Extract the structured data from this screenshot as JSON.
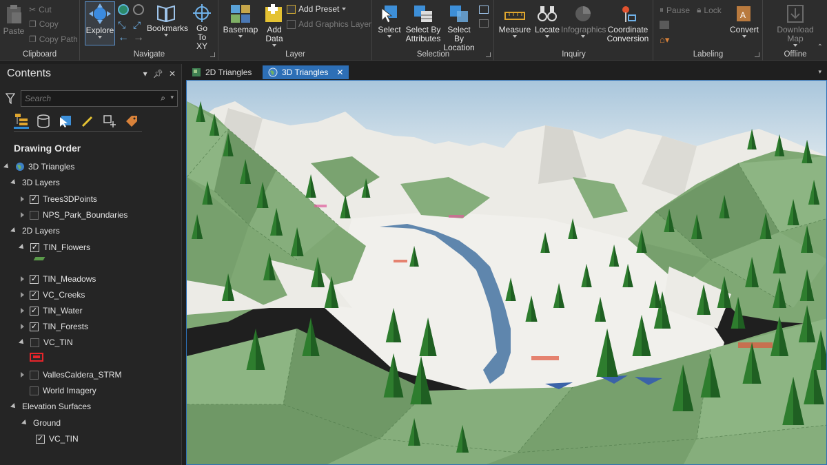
{
  "ribbon": {
    "clipboard": {
      "label": "Clipboard",
      "paste": "Paste",
      "cut": "Cut",
      "copy": "Copy",
      "copy_path": "Copy Path"
    },
    "navigate": {
      "label": "Navigate",
      "explore": "Explore",
      "bookmarks": "Bookmarks",
      "go_to_xy": "Go To XY"
    },
    "layer": {
      "label": "Layer",
      "basemap": "Basemap",
      "add_data": "Add Data",
      "add_preset": "Add Preset",
      "add_graphics_layer": "Add Graphics Layer"
    },
    "selection": {
      "label": "Selection",
      "select": "Select",
      "select_by_attributes": "Select By Attributes",
      "select_by_location": "Select By Location"
    },
    "inquiry": {
      "label": "Inquiry",
      "measure": "Measure",
      "locate": "Locate",
      "infographics": "Infographics",
      "coordinate_conversion": "Coordinate Conversion"
    },
    "labeling": {
      "label": "Labeling",
      "pause": "Pause",
      "lock": "Lock",
      "convert": "Convert"
    },
    "offline": {
      "label": "Offline",
      "download_map": "Download Map"
    }
  },
  "contents": {
    "title": "Contents",
    "search_placeholder": "Search",
    "drawing_order": "Drawing Order",
    "map_name": "3D Triangles",
    "groups": {
      "layers_3d": "3D Layers",
      "layers_2d": "2D Layers",
      "elevation": "Elevation Surfaces",
      "ground": "Ground"
    },
    "layers": {
      "trees": "Trees3DPoints",
      "nps": "NPS_Park_Boundaries",
      "flowers": "TIN_Flowers",
      "meadows": "TIN_Meadows",
      "creeks": "VC_Creeks",
      "water": "TIN_Water",
      "forests": "TIN_Forests",
      "vc_tin": "VC_TIN",
      "strm": "VallesCaldera_STRM",
      "imagery": "World Imagery",
      "ground_tin": "VC_TIN"
    }
  },
  "tabs": [
    {
      "label": "2D Triangles"
    },
    {
      "label": "3D Triangles"
    }
  ],
  "colors": {
    "accent": "#2d6fb6",
    "terrain_green": "#7fa874",
    "tree_green": "#2e7d2e",
    "snow": "#ecebe6",
    "water": "#5f86ad",
    "sky": "#b9d2e4"
  }
}
